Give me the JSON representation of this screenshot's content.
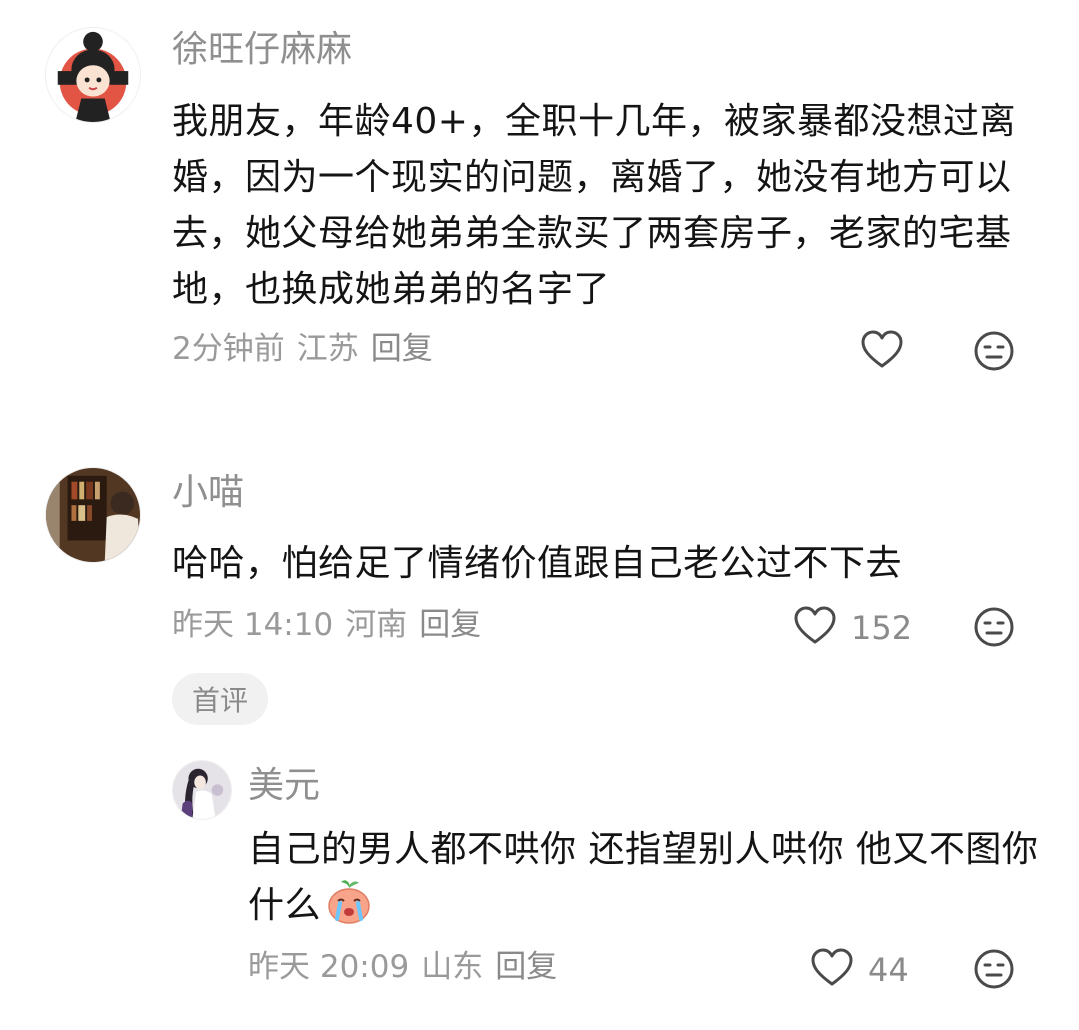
{
  "comments": [
    {
      "username": "徐旺仔麻麻",
      "text": "我朋友，年龄40+，全职十几年，被家暴都没想过离婚，因为一个现实的问题，离婚了，她没有地方可以去，她父母给她弟弟全款买了两套房子，老家的宅基地，也换成她弟弟的名字了",
      "time": "2分钟前",
      "location": "江苏",
      "reply_label": "回复",
      "likes": ""
    },
    {
      "username": "小喵",
      "text": "哈哈，怕给足了情绪价值跟自己老公过不下去",
      "time": "昨天 14:10",
      "location": "河南",
      "reply_label": "回复",
      "likes": "152",
      "badge": "首评",
      "replies": [
        {
          "username": "美元",
          "text": "自己的男人都不哄你 还指望别人哄你 他又不图你什么",
          "time": "昨天 20:09",
          "location": "山东",
          "reply_label": "回复",
          "likes": "44"
        }
      ]
    }
  ],
  "icons": {
    "like": "heart-outline-icon",
    "dislike": "expressionless-face-icon",
    "emoji": "crying-peach-emoji"
  }
}
